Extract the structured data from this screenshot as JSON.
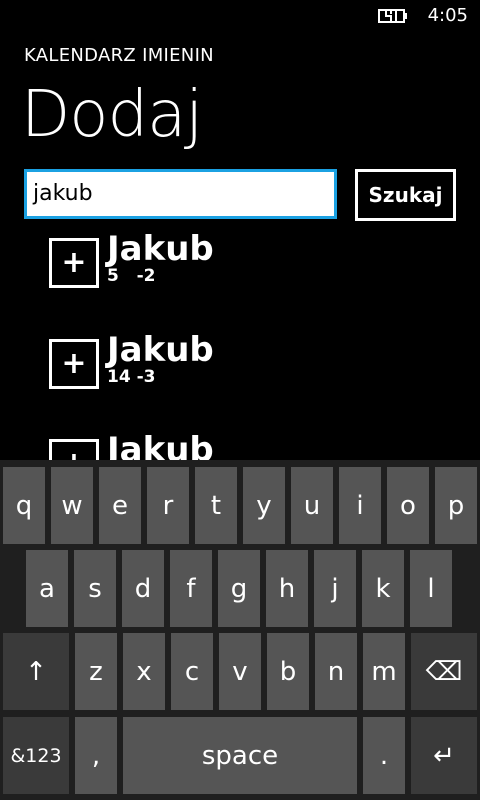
{
  "status": {
    "time": "4:05"
  },
  "app": {
    "title": "KALENDARZ IMIENIN",
    "page_title": "Dodaj"
  },
  "search": {
    "value": "jakub",
    "button_label": "Szukaj"
  },
  "results": [
    {
      "name": "Jakub",
      "date": "5   -2"
    },
    {
      "name": "Jakub",
      "date": "14 -3"
    },
    {
      "name": "Jakub",
      "date": ""
    }
  ],
  "keyboard": {
    "row1": [
      "q",
      "w",
      "e",
      "r",
      "t",
      "y",
      "u",
      "i",
      "o",
      "p"
    ],
    "row2": [
      "a",
      "s",
      "d",
      "f",
      "g",
      "h",
      "j",
      "k",
      "l"
    ],
    "row3": [
      "z",
      "x",
      "c",
      "v",
      "b",
      "n",
      "m"
    ],
    "shift_symbol": "↑",
    "backspace_symbol": "⌫",
    "numbers_label": "&123",
    "comma": ",",
    "space_label": "space",
    "period": ".",
    "enter_symbol": "↵"
  },
  "colors": {
    "accent": "#1ba1e2",
    "key": "#555555",
    "keyboard_bg": "#1f1f1f"
  }
}
